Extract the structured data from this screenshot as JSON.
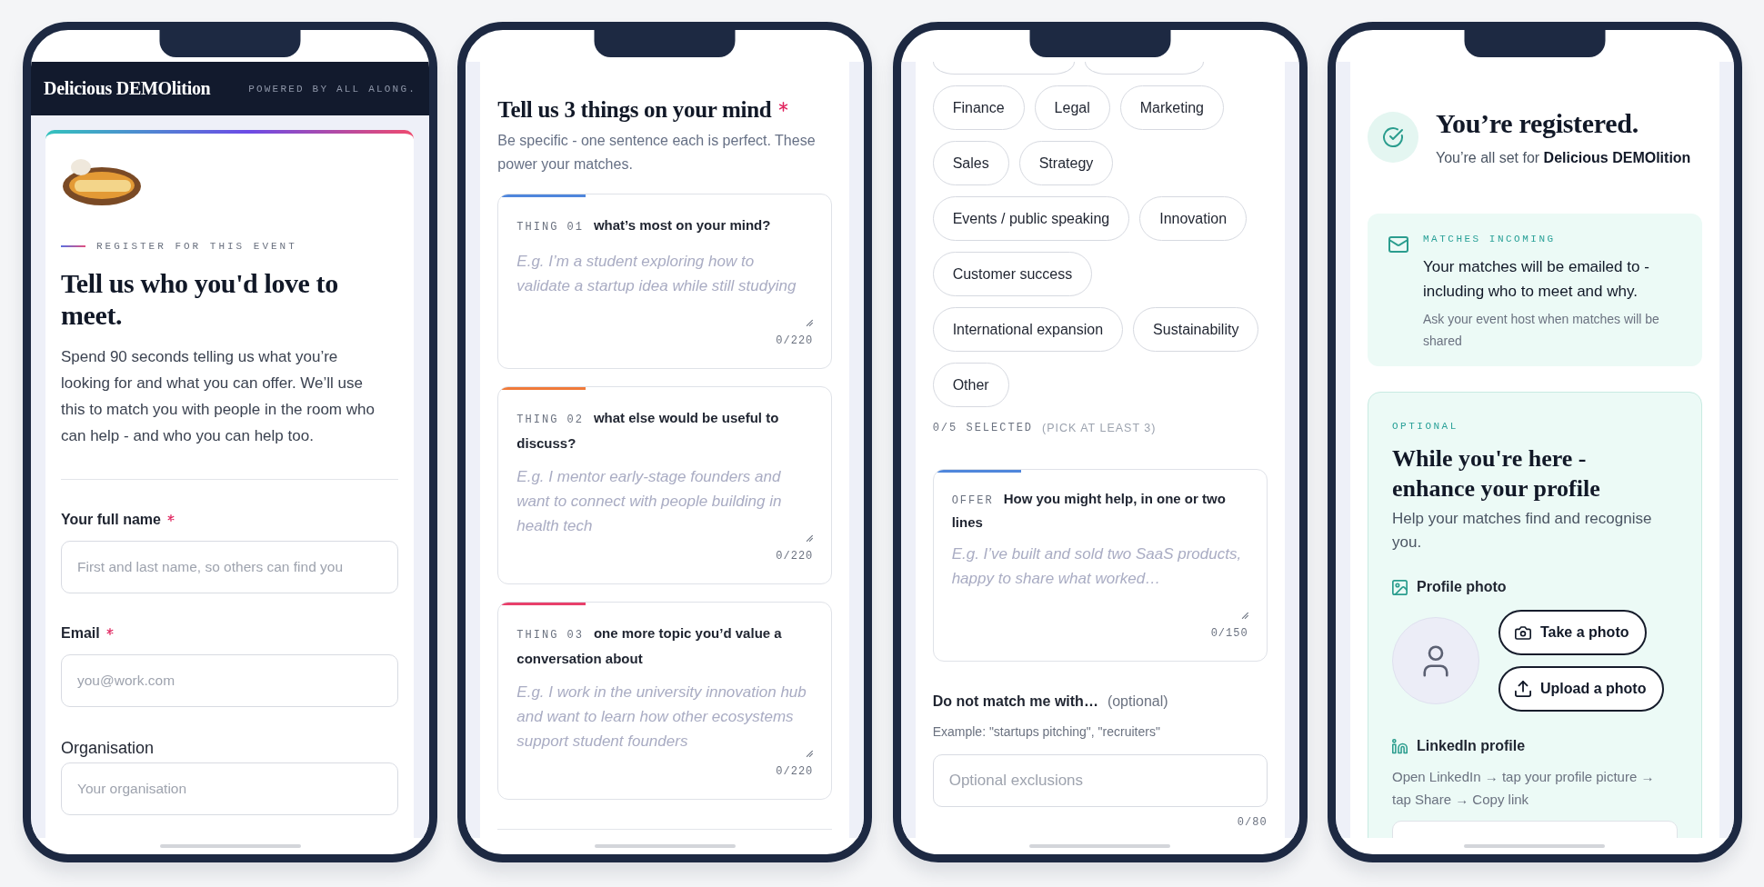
{
  "phones": [
    {
      "kind": "registration_intro",
      "header": {
        "brand": "Delicious DEMOlition",
        "tagline": "POWERED BY ALL ALONG."
      },
      "eyebrow": "REGISTER FOR THIS EVENT",
      "title": "Tell us who you'd love to meet.",
      "intro": "Spend 90 seconds telling us what you’re looking for and what you can offer. We’ll use this to match you with people in the room who can help - and who you can help too.",
      "fields": [
        {
          "label": "Your full name",
          "required": true,
          "placeholder": "First and last name, so others can find you"
        },
        {
          "label": "Email",
          "required": true,
          "placeholder": "you@work.com"
        },
        {
          "label": "Organisation",
          "required": false,
          "placeholder": "Your organisation"
        }
      ]
    },
    {
      "kind": "topics",
      "title": "Tell us 3 things on your mind",
      "required": true,
      "subtitle": "Be specific - one sentence each is perfect. These power your matches.",
      "prompts": [
        {
          "tag": "THING 01",
          "question": "what’s most on your mind?",
          "placeholder": "E.g. I’m a student exploring how to validate a startup idea while still studying",
          "counter": "0/220",
          "color": "#4f86dc"
        },
        {
          "tag": "THING 02",
          "question": "what else would be useful to discuss?",
          "placeholder": "E.g. I mentor early-stage founders and want to connect with people building in health tech",
          "counter": "0/220",
          "color": "#f07a3a"
        },
        {
          "tag": "THING 03",
          "question": "one more topic you’d value a conversation about",
          "placeholder": "E.g. I work in the university innovation hub and want to learn how other ecosystems support student founders",
          "counter": "0/220",
          "color": "#e8406b"
        }
      ]
    },
    {
      "kind": "interests_offer",
      "chips": [
        {
          "kind": "clipped",
          "selected": false
        },
        {
          "kind": "clipped",
          "selected": false
        },
        {
          "kind": "option",
          "label": "Finance",
          "selected": false
        },
        {
          "kind": "option",
          "label": "Legal",
          "selected": false
        },
        {
          "kind": "option",
          "label": "Marketing",
          "selected": false
        },
        {
          "kind": "option",
          "label": "Sales",
          "selected": false
        },
        {
          "kind": "option",
          "label": "Strategy",
          "selected": false
        },
        {
          "kind": "option",
          "label": "Events / public speaking",
          "selected": false
        },
        {
          "kind": "option",
          "label": "Innovation",
          "selected": false
        },
        {
          "kind": "option",
          "label": "Customer success",
          "selected": false
        },
        {
          "kind": "option",
          "label": "International expansion",
          "selected": false
        },
        {
          "kind": "option",
          "label": "Sustainability",
          "selected": false
        },
        {
          "kind": "option",
          "label": "Other",
          "selected": false
        }
      ],
      "selection_count": "0/5 SELECTED",
      "selection_hint": "(PICK AT LEAST 3)",
      "offer": {
        "tag": "OFFER",
        "question": "How you might help, in one or two lines",
        "placeholder": "E.g. I’ve built and sold two SaaS products, happy to share what worked…",
        "counter": "0/150",
        "color": "#4f86dc"
      },
      "exclusions": {
        "label": "Do not match me with…",
        "note": "(optional)",
        "hint": "Example: \"startups pitching\", \"recruiters\"",
        "placeholder": "Optional exclusions",
        "counter": "0/80"
      }
    },
    {
      "kind": "confirmation",
      "title": "You’re registered.",
      "subtitle": "You’re all set for **Delicious DEMOlition**",
      "notice": {
        "eyebrow": "MATCHES INCOMING",
        "message": "Your matches will be emailed to - including who to meet and why.",
        "note": "Ask your event host when matches will be shared"
      },
      "profile": {
        "eyebrow": "OPTIONAL",
        "title": "While you're here - enhance your profile",
        "intro": "Help your matches find and recognise you.",
        "photo_label": "Profile photo",
        "actions": [
          {
            "kind": "camera",
            "label": "Take a photo"
          },
          {
            "kind": "upload",
            "label": "Upload a photo"
          }
        ],
        "linkedin_label": "LinkedIn profile",
        "linkedin_hint": "Open LinkedIn → tap your profile picture → tap Share → Copy link",
        "linkedin_field": true
      }
    }
  ]
}
